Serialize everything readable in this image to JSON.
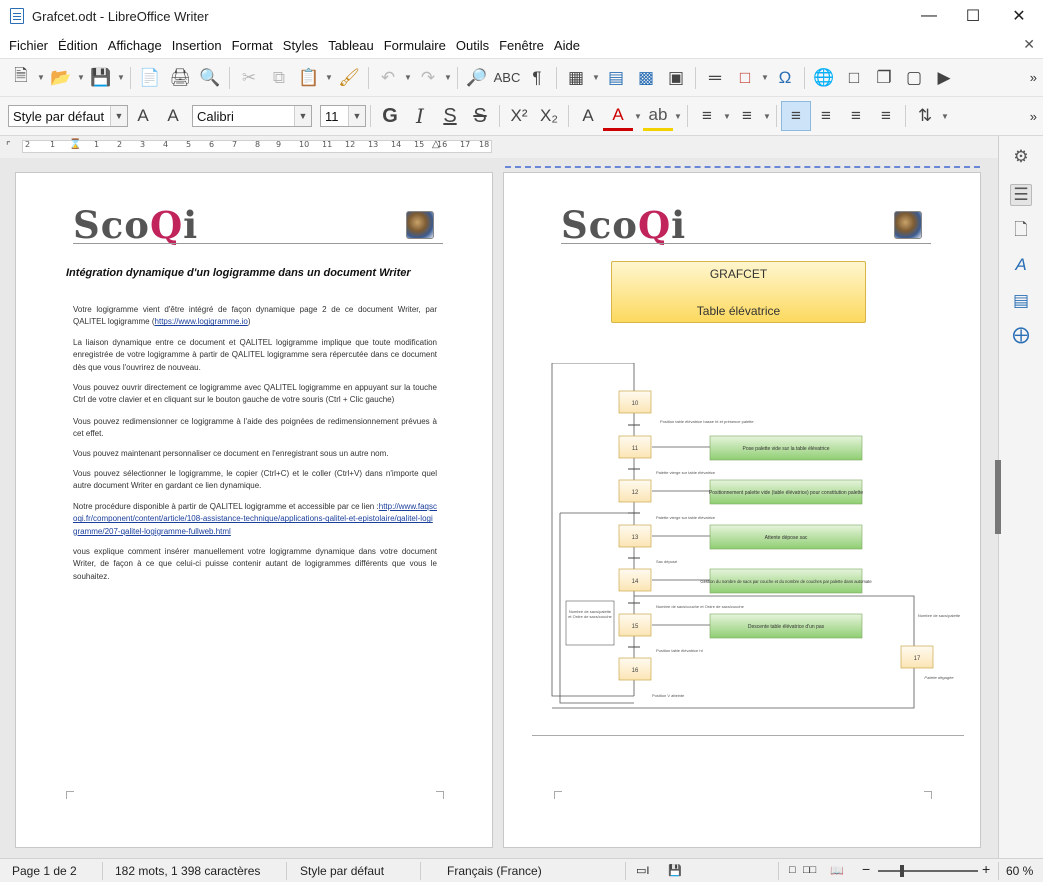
{
  "window": {
    "title": "Grafcet.odt - LibreOffice Writer"
  },
  "menu": [
    "Fichier",
    "Édition",
    "Affichage",
    "Insertion",
    "Format",
    "Styles",
    "Tableau",
    "Formulaire",
    "Outils",
    "Fenêtre",
    "Aide"
  ],
  "format_toolbar": {
    "paragraph_style": "Style par défaut",
    "font_name": "Calibri",
    "font_size": "11"
  },
  "ruler": {
    "labels": [
      "2",
      "1",
      "1",
      "2",
      "3",
      "4",
      "5",
      "6",
      "7",
      "8",
      "9",
      "10",
      "11",
      "12",
      "13",
      "14",
      "15",
      "16",
      "17",
      "18"
    ]
  },
  "page1": {
    "logo_text": "Sco",
    "logo_q": "Q",
    "logo_i": "i",
    "title": "Intégration dynamique d'un logigramme dans  un document Writer",
    "p1a": "Votre logigramme vient d'être intégré de façon dynamique page 2 de ce document Writer, par QALITEL logigramme (",
    "p1link": "https://www.logigramme.io",
    "p1b": ")",
    "p2": "La liaison dynamique entre ce document et QALITEL logigramme implique que toute modification enregistrée de votre logigramme à partir de QALITEL logigramme sera répercutée dans ce document dès que vous l'ouvrirez de nouveau.",
    "p3": "Vous pouvez ouvrir directement ce logigramme avec QALITEL logigramme en appuyant sur la touche Ctrl de votre clavier et en cliquant sur le bouton gauche de votre souris (Ctrl + Clic gauche)",
    "p4": "Vous pouvez redimensionner ce logigramme à l'aide des poignées de redimensionnement prévues à cet effet.",
    "p5": "Vous pouvez maintenant personnaliser ce document en l'enregistrant sous un autre nom.",
    "p6": "Vous pouvez sélectionner le logigramme, le copier (Ctrl+C) et le coller (Ctrl+V) dans n'importe quel autre document Writer en gardant ce lien dynamique.",
    "p7a": "Notre procédure disponible à partir de QALITEL logigramme et accessible par ce lien :",
    "p7link": "http://www.faqscoqi.fr/component/content/article/108-assistance-technique/applications-qalitel-et-epistolaire/qalitel-logigramme/207-qalitel-logigramme-fullweb.html",
    "p8": "vous explique comment insérer manuellement votre logigramme dynamique dans votre document Writer, de façon à ce que celui-ci puisse contenir autant de logigrammes différents que  vous le souhaitez."
  },
  "page2": {
    "grafcet_title": "GRAFCET",
    "grafcet_subtitle": "Table élévatrice",
    "steps": [
      "10",
      "11",
      "12",
      "13",
      "14",
      "15",
      "16",
      "17"
    ],
    "actions": [
      "Pose palette vide sur la table élévatrice",
      "Positionnement palette vide (table élévatrice) pour constitution palette",
      "Attente dépose sac",
      "Gestion du nombre de sacs par couche et du nombre de couches par palette dans automate",
      "Descente table élévatrice d'un pas"
    ],
    "transitions": [
      "Position table élévatrice basse ht et présence palette",
      "Palette vierge sur table élévatrice",
      "Palette vierge sur table élévatrice",
      "Sac déposé",
      "Nombre de sacs/couche et Ordre de sacs/couche",
      "Position table élévatrice ht",
      "Position V atteinte"
    ],
    "side_note_left": "Nombre de sacs/palette et Ordre de sacs/couche",
    "side_note_right_top": "Nombre de sacs/palette",
    "side_note_right_bottom": "Palette dégagée"
  },
  "status": {
    "page": "Page 1 de 2",
    "words": "182 mots, 1 398 caractères",
    "style": "Style par défaut",
    "language": "Français (France)",
    "zoom": "60 %"
  }
}
